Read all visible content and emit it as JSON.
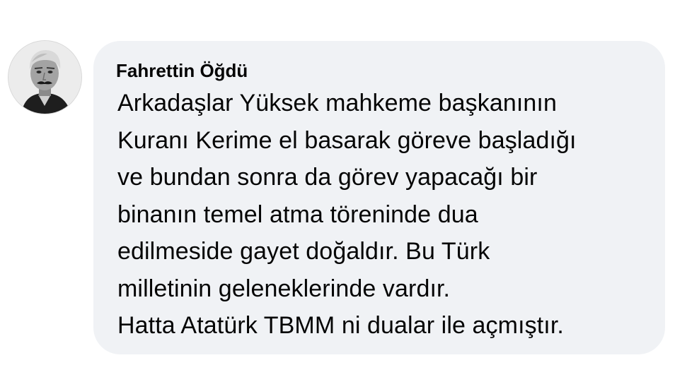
{
  "comment": {
    "author": "Fahrettin Öğdü",
    "avatar_icon": "profile-photo",
    "lines": [
      "Arkadaşlar Yüksek mahkeme başkanının",
      "Kuranı Kerime el basarak göreve başladığı",
      "ve bundan sonra da görev yapacağı bir",
      "binanın temel atma töreninde dua",
      "edilmeside gayet doğaldır. Bu Türk",
      "milletinin geleneklerinde vardır.",
      "Hatta Atatürk TBMM ni dualar ile açmıştır."
    ]
  },
  "colors": {
    "bubble_background": "#f0f2f5",
    "text": "#050505",
    "page_background": "#ffffff"
  }
}
